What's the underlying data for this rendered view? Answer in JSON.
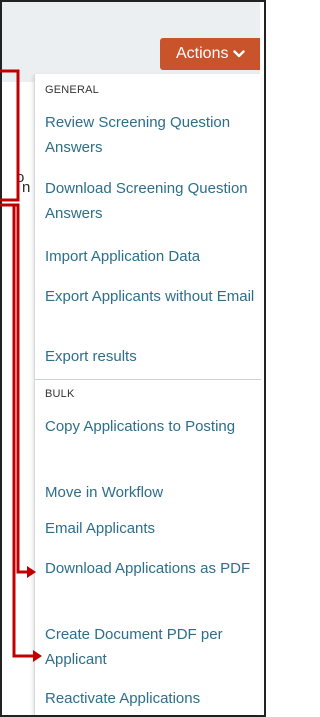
{
  "page": {
    "partial_text_1": "o",
    "partial_text_2": "n"
  },
  "actions_button": {
    "label": "Actions",
    "icon": "chevron-down-icon",
    "color": "#c9532b"
  },
  "menu": {
    "sections": [
      {
        "title": "GENERAL",
        "items": [
          {
            "label": "Review Screening Question Answers"
          },
          {
            "label": "Download Screening Question Answers"
          },
          {
            "label": "Import Application Data"
          },
          {
            "label": "Export Applicants without Email"
          },
          {
            "label": "Export results"
          }
        ]
      },
      {
        "title": "BULK",
        "items": [
          {
            "label": "Copy Applications to Posting"
          },
          {
            "label": "Move in Workflow"
          },
          {
            "label": "Email Applicants"
          },
          {
            "label": "Download Applications as PDF"
          },
          {
            "label": "Create Document PDF per Applicant"
          },
          {
            "label": "Reactivate Applications"
          }
        ]
      }
    ]
  },
  "colors": {
    "link": "#2d6e8a",
    "annotation": "#c00000"
  }
}
